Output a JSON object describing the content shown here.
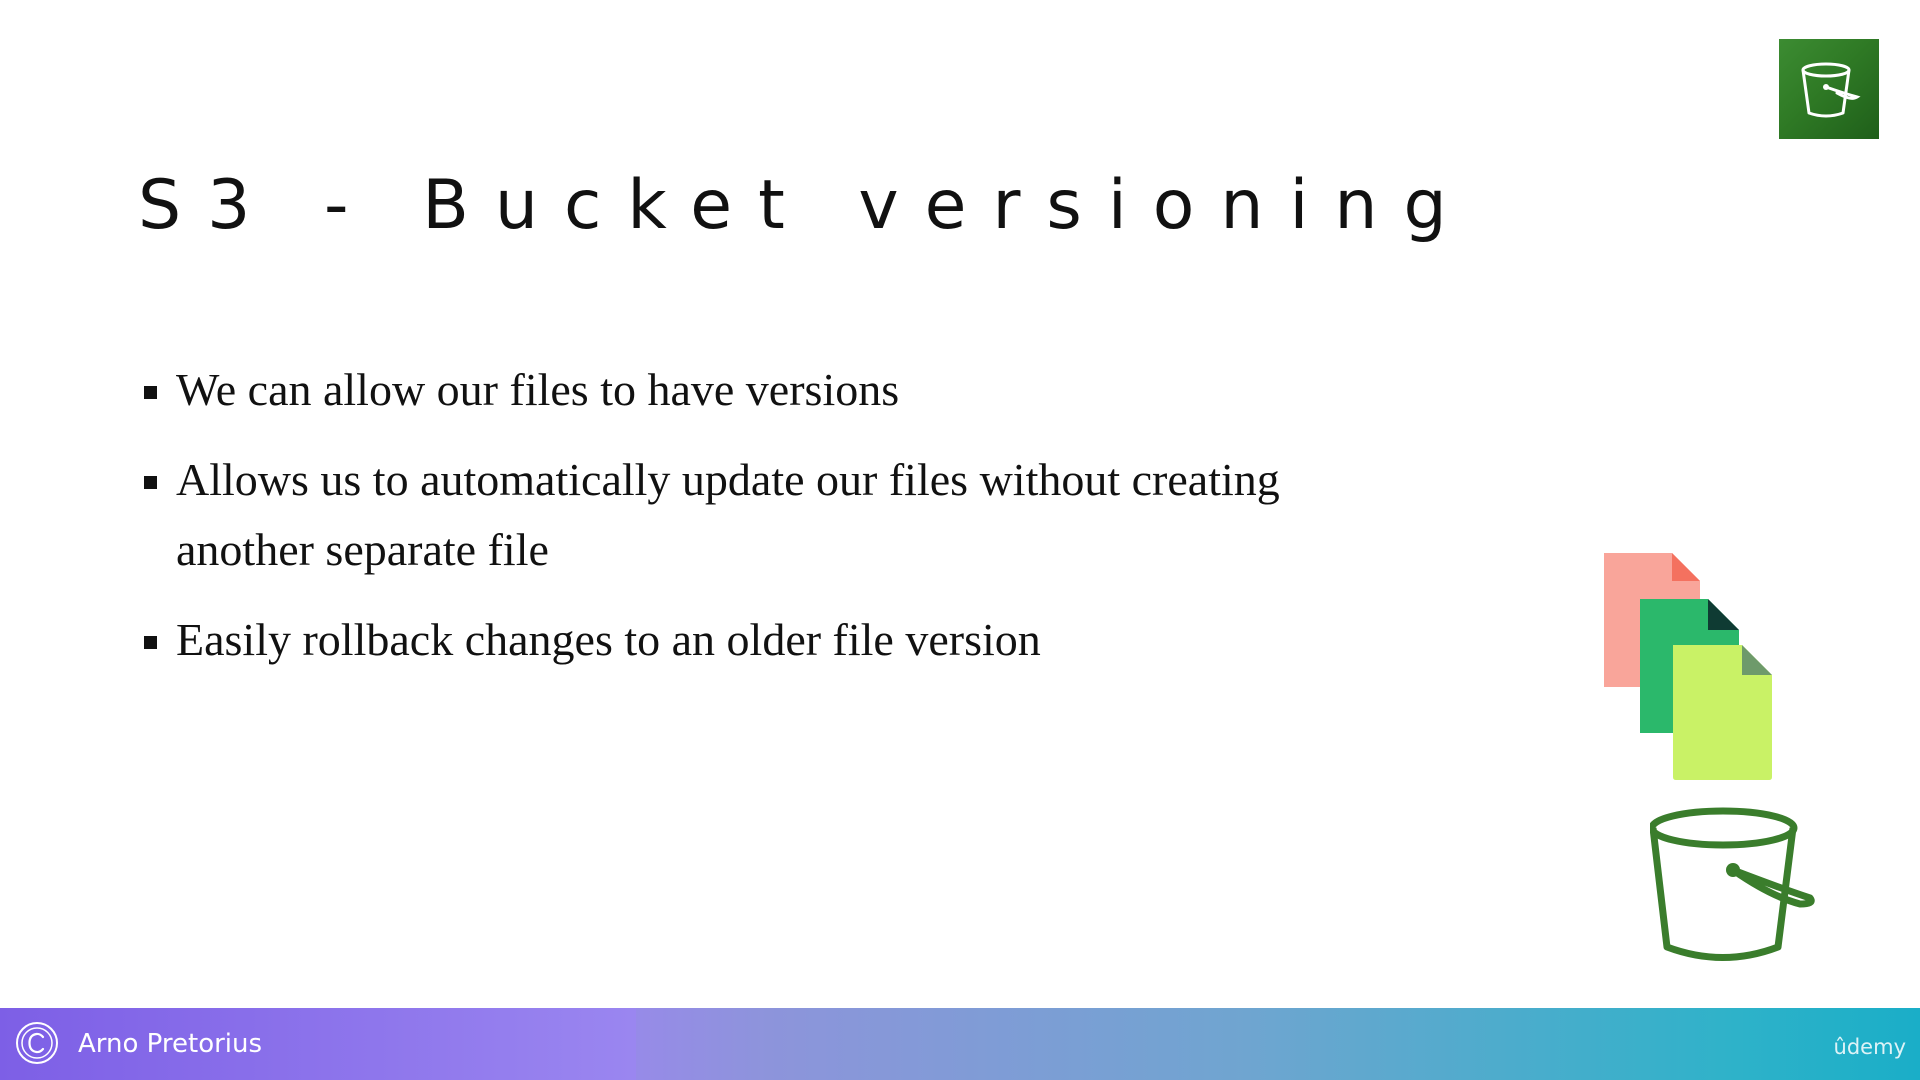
{
  "slide": {
    "title": "S3 - Bucket versioning",
    "bullets": [
      "We can allow our files to have versions",
      "Allows us to automatically update our files without creating another separate file",
      "Easily rollback changes to an older file version"
    ]
  },
  "icons": {
    "badge": "s3-bucket-icon",
    "documents": "document-stack-icon",
    "bucket": "bucket-icon",
    "copyright": "copyright-icon"
  },
  "footer": {
    "author": "Arno Pretorius",
    "brand": "ûdemy"
  },
  "colors": {
    "badge_green": "#2f7a25",
    "bucket_green": "#3a7d2c",
    "doc_salmon": "#f9a59a",
    "doc_green": "#2bb86b",
    "doc_lime": "#c9f266",
    "footer_purple": "#8a6ee8",
    "footer_teal": "#1aaec8"
  }
}
